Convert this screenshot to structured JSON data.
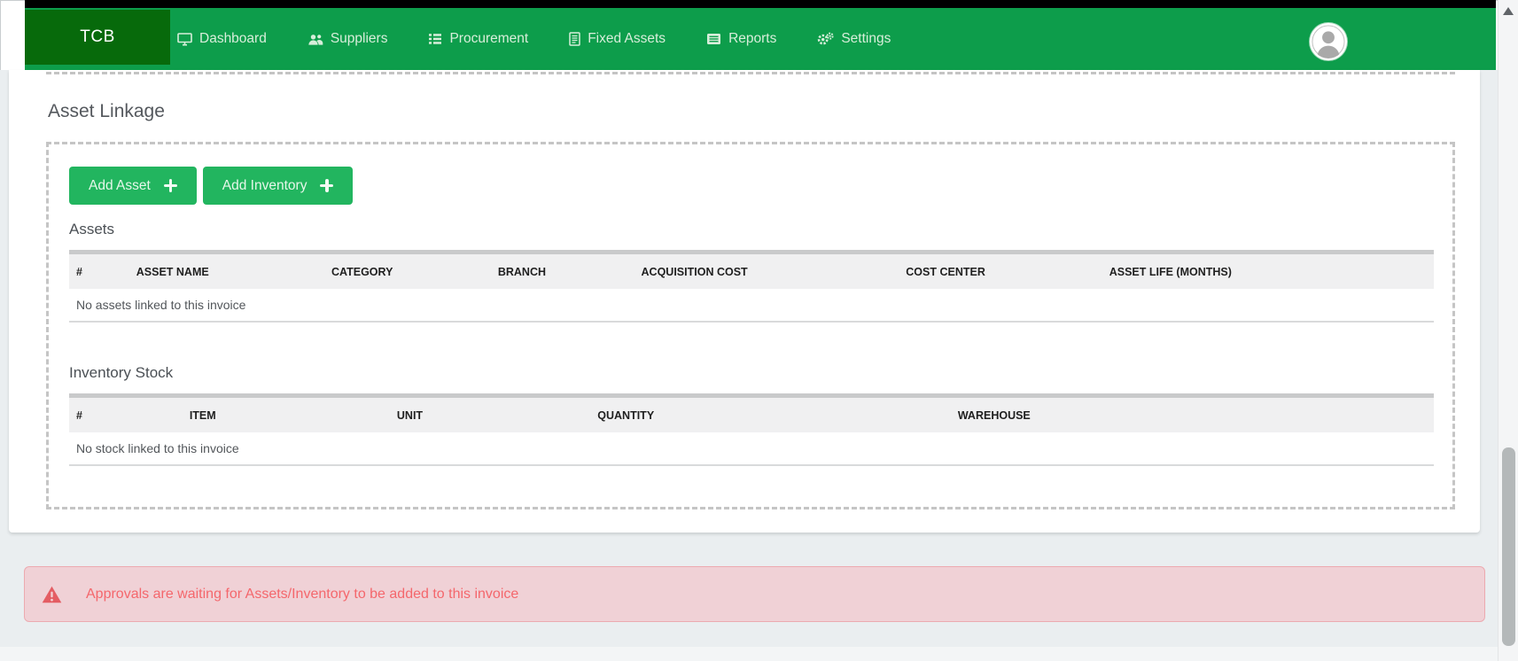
{
  "nav": {
    "brand": "TCB",
    "items": [
      {
        "label": "Dashboard",
        "icon": "dashboard-icon"
      },
      {
        "label": "Suppliers",
        "icon": "suppliers-icon"
      },
      {
        "label": "Procurement",
        "icon": "procurement-icon"
      },
      {
        "label": "Fixed Assets",
        "icon": "fixed-assets-icon"
      },
      {
        "label": "Reports",
        "icon": "reports-icon"
      },
      {
        "label": "Settings",
        "icon": "settings-icon"
      }
    ]
  },
  "page": {
    "title": "Asset Linkage"
  },
  "toolbar": {
    "add_asset_label": "Add Asset",
    "add_inventory_label": "Add Inventory"
  },
  "assets_section": {
    "heading": "Assets",
    "columns": [
      "#",
      "ASSET NAME",
      "CATEGORY",
      "BRANCH",
      "ACQUISITION COST",
      "COST CENTER",
      "ASSET LIFE (MONTHS)"
    ],
    "rows": [],
    "empty_message": "No assets linked to this invoice"
  },
  "inventory_section": {
    "heading": "Inventory Stock",
    "columns": [
      "#",
      "ITEM",
      "UNIT",
      "QUANTITY",
      "WAREHOUSE"
    ],
    "rows": [],
    "empty_message": "No stock linked to this invoice"
  },
  "alert": {
    "message": "Approvals are waiting for Assets/Inventory to be added to this invoice"
  },
  "colors": {
    "nav_green": "#0d9d4b",
    "brand_green": "#076a0b",
    "button_green": "#22b55f",
    "page_bg": "#eaeef0",
    "alert_bg": "#f0d1d6",
    "alert_border": "#ecaab0",
    "alert_text": "#f4676c",
    "warning_icon": "#e45d63",
    "table_header_bg": "#f0f0f1",
    "table_topbar": "#c9cacb"
  }
}
